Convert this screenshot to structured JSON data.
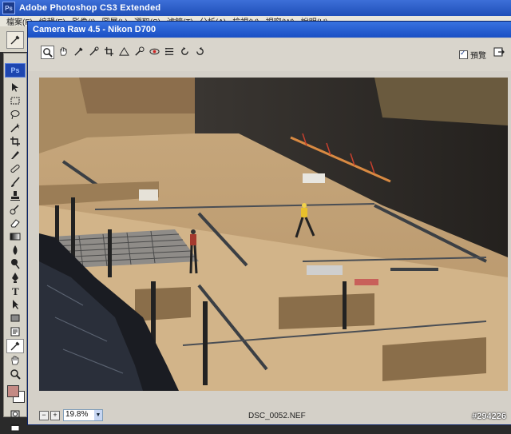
{
  "app": {
    "title": "Adobe Photoshop CS3 Extended",
    "logo": "Ps",
    "menu": [
      "檔案(F)",
      "編輯(E)",
      "影像(I)",
      "圖層(L)",
      "選取(S)",
      "濾鏡(T)",
      "分析(A)",
      "檢視(V)",
      "視窗(W)",
      "說明(H)"
    ]
  },
  "tools": {
    "logo": "Ps",
    "items": [
      "move-icon",
      "marquee-icon",
      "lasso-icon",
      "magic-wand-icon",
      "crop-icon",
      "slice-icon",
      "healing-icon",
      "brush-icon",
      "stamp-icon",
      "history-brush-icon",
      "eraser-icon",
      "gradient-icon",
      "blur-icon",
      "dodge-icon",
      "pen-icon",
      "type-icon",
      "path-select-icon",
      "rectangle-icon",
      "notes-icon",
      "eyedropper-icon",
      "hand-icon",
      "zoom-icon"
    ],
    "foreground_color": "#c48a84",
    "background_color": "#ffffff"
  },
  "dialog": {
    "title": "Camera Raw 4.5  -  Nikon D700",
    "toolbar": [
      "zoom-icon",
      "hand-icon",
      "white-balance-icon",
      "color-sampler-icon",
      "crop-icon",
      "straighten-icon",
      "retouch-icon",
      "red-eye-icon",
      "preferences-icon",
      "rotate-left-icon",
      "rotate-right-icon"
    ],
    "preview_label": "預覽",
    "preview_checked": true,
    "zoom_minus": "−",
    "zoom_plus": "+",
    "zoom_level": "19.8%",
    "filename": "DSC_0052.NEF"
  },
  "watermark": "#294226"
}
